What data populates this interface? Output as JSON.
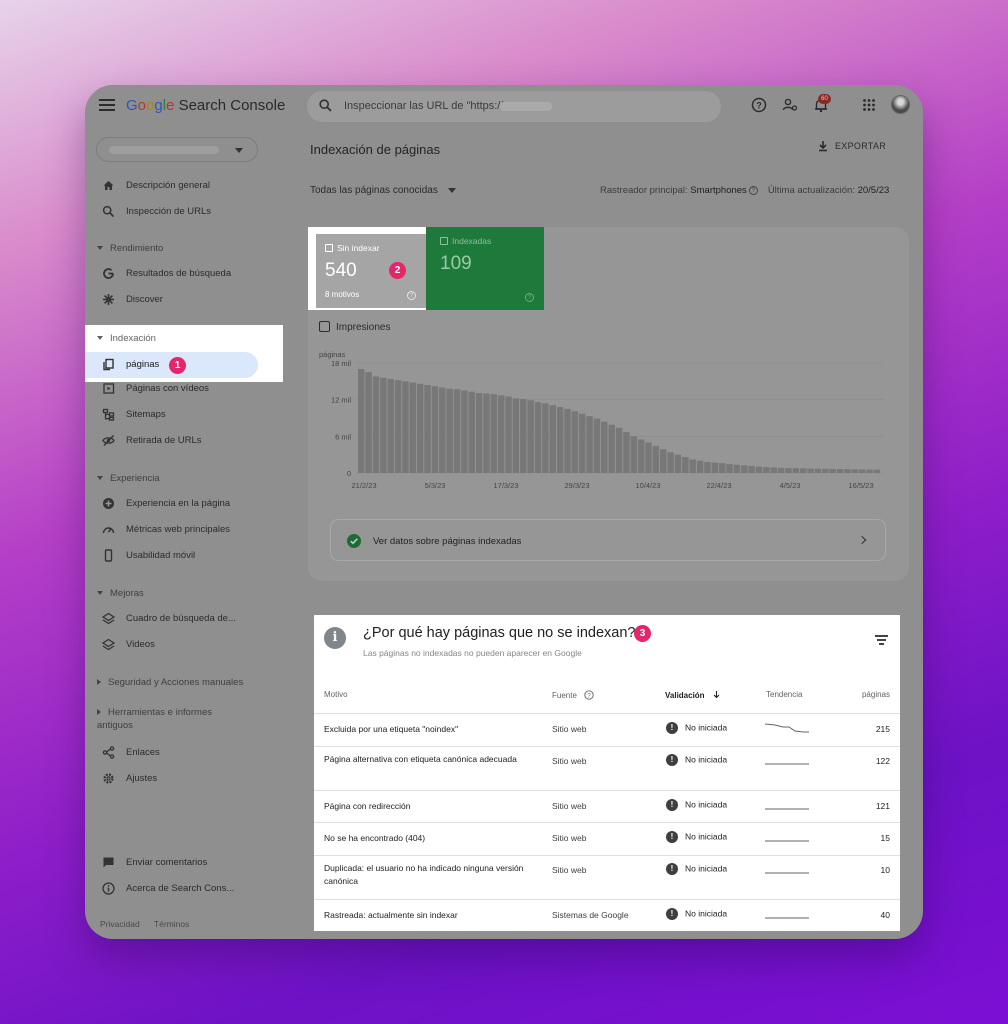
{
  "app": {
    "logo_google": [
      "G",
      "o",
      "o",
      "g",
      "l",
      "e"
    ],
    "logo_product": "Search Console",
    "search_placeholder": "Inspeccionar las URL de \"https://",
    "notification_count": "60"
  },
  "sidebar": {
    "items_top": [
      {
        "label": "Descripción general",
        "icon": "home-icon"
      },
      {
        "label": "Inspección de URLs",
        "icon": "search-icon"
      }
    ],
    "sections": [
      {
        "title": "Rendimiento",
        "items": [
          {
            "label": "Resultados de búsqueda",
            "icon": "google-g-icon"
          },
          {
            "label": "Discover",
            "icon": "asterisk-icon"
          }
        ]
      },
      {
        "title": "Indexación",
        "items": [
          {
            "label": "páginas",
            "icon": "pages-icon"
          },
          {
            "label": "Páginas con vídeos",
            "icon": "video-pages-icon"
          },
          {
            "label": "Sitemaps",
            "icon": "sitemap-icon"
          },
          {
            "label": "Retirada de URLs",
            "icon": "visibility-off-icon"
          }
        ]
      },
      {
        "title": "Experiencia",
        "items": [
          {
            "label": "Experiencia en la página",
            "icon": "plus-circle-icon"
          },
          {
            "label": "Métricas web principales",
            "icon": "speed-icon"
          },
          {
            "label": "Usabilidad móvil",
            "icon": "phone-icon"
          }
        ]
      },
      {
        "title": "Mejoras",
        "items": [
          {
            "label": "Cuadro de búsqueda de...",
            "icon": "layers-icon"
          },
          {
            "label": "Videos",
            "icon": "layers-icon"
          }
        ]
      }
    ],
    "collapsed_sections": [
      "Seguridad y Acciones manuales",
      "Herramientas e informes antiguos"
    ],
    "items_bottom": [
      {
        "label": "Enlaces",
        "icon": "links-icon"
      },
      {
        "label": "Ajustes",
        "icon": "gear-icon"
      }
    ],
    "footer_items": [
      {
        "label": "Enviar comentarios",
        "icon": "feedback-icon"
      },
      {
        "label": "Acerca de Search Cons...",
        "icon": "info-icon"
      }
    ],
    "footer_links": [
      "Privacidad",
      "Términos"
    ],
    "badge_1": "1"
  },
  "main": {
    "title": "Indexación de páginas",
    "export_label": "EXPORTAR",
    "filter_label": "Todas las páginas conocidas",
    "crawler_label": "Rastreador principal:",
    "crawler_value": "Smartphones",
    "updated_label": "Última actualización:",
    "updated_value": "20/5/23",
    "tiles": {
      "not_indexed": {
        "label": "Sin indexar",
        "value": "540",
        "sub": "8 motivos"
      },
      "indexed": {
        "label": "Indexadas",
        "value": "109"
      },
      "badge_2": "2"
    },
    "impressions_label": "Impresiones",
    "view_indexed_label": "Ver datos sobre páginas indexadas"
  },
  "chart_data": {
    "type": "bar",
    "ylabel": "páginas",
    "y_ticks": [
      "18 mil",
      "12 mil",
      "6 mil",
      "0"
    ],
    "x_ticks": [
      "21/2/23",
      "5/3/23",
      "17/3/23",
      "29/3/23",
      "10/4/23",
      "22/4/23",
      "4/5/23",
      "16/5/23"
    ],
    "ylim": [
      0,
      18000
    ],
    "values": [
      17000,
      16500,
      15800,
      15600,
      15400,
      15200,
      15000,
      14800,
      14600,
      14400,
      14200,
      14000,
      13800,
      13700,
      13500,
      13300,
      13100,
      13000,
      12900,
      12700,
      12500,
      12200,
      12100,
      11900,
      11600,
      11400,
      11100,
      10800,
      10500,
      10100,
      9700,
      9300,
      8900,
      8400,
      7900,
      7400,
      6700,
      6000,
      5500,
      5000,
      4400,
      3900,
      3400,
      3000,
      2600,
      2200,
      2000,
      1800,
      1700,
      1600,
      1450,
      1350,
      1250,
      1150,
      1050,
      950,
      900,
      850,
      800,
      780,
      750,
      730,
      710,
      690,
      670,
      650,
      620,
      600,
      580,
      560,
      540
    ]
  },
  "reasons": {
    "title": "¿Por qué hay páginas que no se indexan?",
    "subtitle": "Las páginas no indexadas no pueden aparecer en Google",
    "badge_3": "3",
    "headers": {
      "reason": "Motivo",
      "source": "Fuente",
      "validation": "Validación",
      "trend": "Tendencia",
      "pages": "páginas"
    },
    "rows": [
      {
        "reason": "Excluida por una etiqueta \"noindex\"",
        "source": "Sitio web",
        "validation": "No iniciada",
        "pages": "215",
        "trend": "down"
      },
      {
        "reason": "Página alternativa con etiqueta canónica adecuada",
        "source": "Sitio web",
        "validation": "No iniciada",
        "pages": "122",
        "trend": "flat"
      },
      {
        "reason": "Página con redirección",
        "source": "Sitio web",
        "validation": "No iniciada",
        "pages": "121",
        "trend": "flat"
      },
      {
        "reason": "No se ha encontrado (404)",
        "source": "Sitio web",
        "validation": "No iniciada",
        "pages": "15",
        "trend": "flat"
      },
      {
        "reason": "Duplicada: el usuario no ha indicado ninguna versión canónica",
        "source": "Sitio web",
        "validation": "No iniciada",
        "pages": "10",
        "trend": "flat"
      },
      {
        "reason": "Rastreada: actualmente sin indexar",
        "source": "Sistemas de Google",
        "validation": "No iniciada",
        "pages": "40",
        "trend": "flat"
      }
    ]
  }
}
